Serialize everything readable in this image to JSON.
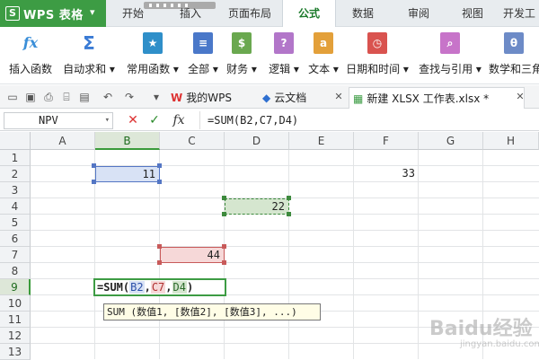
{
  "app": {
    "name": "WPS 表格",
    "logo_letter": "S"
  },
  "menu_tabs": [
    "开始",
    "插入",
    "页面布局",
    "公式",
    "数据",
    "审阅",
    "视图",
    "开发工"
  ],
  "ribbon": [
    {
      "label": "插入函数",
      "icon": "fx-icon",
      "symbol": "fx",
      "color": "#3a8ed8"
    },
    {
      "label": "自动求和",
      "icon": "sigma-icon",
      "symbol": "Σ",
      "color": "#3a7bd5"
    },
    {
      "label": "常用函数",
      "icon": "star-book-icon",
      "symbol": "★",
      "color": "#2f8fc9"
    },
    {
      "label": "全部",
      "icon": "book-icon",
      "symbol": "≡",
      "color": "#4a78c9"
    },
    {
      "label": "财务",
      "icon": "money-icon",
      "symbol": "$",
      "color": "#6aa84f"
    },
    {
      "label": "逻辑",
      "icon": "question-icon",
      "symbol": "?",
      "color": "#b276c9"
    },
    {
      "label": "文本",
      "icon": "text-a-icon",
      "symbol": "a",
      "color": "#e3a03a"
    },
    {
      "label": "日期和时间",
      "icon": "clock-icon",
      "symbol": "◷",
      "color": "#d9534f"
    },
    {
      "label": "查找与引用",
      "icon": "search-icon",
      "symbol": "⌕",
      "color": "#c774c9"
    },
    {
      "label": "数学和三角",
      "icon": "theta-icon",
      "symbol": "θ",
      "color": "#6d8bc7"
    }
  ],
  "doc_tabs": [
    {
      "label": "我的WPS",
      "icon": "wps-w-icon"
    },
    {
      "label": "云文档",
      "icon": "cube-icon"
    },
    {
      "label": "新建 XLSX 工作表.xlsx *",
      "icon": "sheet-icon"
    }
  ],
  "formula_bar": {
    "name_box": "NPV",
    "cancel_symbol": "✕",
    "ok_symbol": "✓",
    "fx_label": "fx",
    "formula": "=SUM(B2,C7,D4)"
  },
  "columns": [
    "A",
    "B",
    "C",
    "D",
    "E",
    "F",
    "G",
    "H"
  ],
  "rows": [
    "1",
    "2",
    "3",
    "4",
    "5",
    "6",
    "7",
    "8",
    "9",
    "10",
    "11",
    "12",
    "13"
  ],
  "active_column": "B",
  "active_row": "9",
  "cells": {
    "B2": "11",
    "F2": "33",
    "D4": "22",
    "D7": "44"
  },
  "edit_cell": {
    "prefix": "=SUM(",
    "ref1": "B2",
    "sep1": ",",
    "ref2": "C7",
    "sep2": ",",
    "ref3": "D4",
    "suffix": ")"
  },
  "tooltip": "SUM (数值1, [数值2], [数值3], ...)",
  "watermark": {
    "main": "Baidu经验",
    "sub": "jingyan.baidu.com"
  },
  "colors": {
    "accent": "#3d9c44",
    "ref_blue": "#5476c4",
    "ref_red": "#c85a5a",
    "ref_green": "#3d8a3d"
  }
}
